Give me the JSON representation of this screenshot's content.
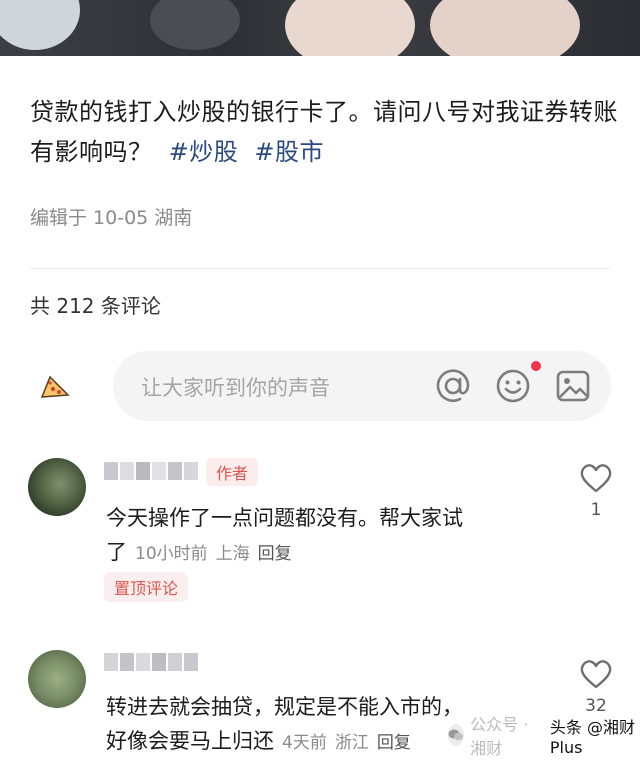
{
  "post": {
    "text": "贷款的钱打入炒股的银行卡了。请问八号对我证券转账有影响吗？",
    "tags": [
      "#炒股",
      "#股市"
    ],
    "meta": "编辑于 10-05 湖南"
  },
  "comments_header": {
    "count_text": "共 212 条评论"
  },
  "composer": {
    "placeholder": "让大家听到你的声音",
    "icons": [
      "at-icon",
      "emoji-icon",
      "image-icon"
    ],
    "notification_dot_color": "#f2334c"
  },
  "comments": [
    {
      "badge": "作者",
      "text_line1": "今天操作了一点问题都没有。帮大家试",
      "text_line2": "了",
      "time": "10小时前",
      "location": "上海",
      "reply": "回复",
      "pinned": "置顶评论",
      "likes": "1"
    },
    {
      "text_line1": "转进去就会抽贷，规定是不能入市的，",
      "text_line2": "好像会要马上归还",
      "time": "4天前",
      "location": "浙江",
      "reply": "回复",
      "likes": "32"
    }
  ],
  "watermark": {
    "faded": "公众号 · 湘财",
    "brand": "头条 @湘财Plus"
  },
  "colors": {
    "accent_red": "#e0564f",
    "tag_blue": "#2a4a7f"
  }
}
